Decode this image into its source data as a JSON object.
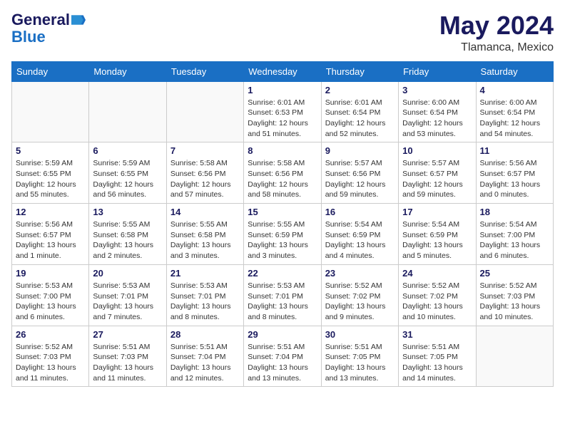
{
  "header": {
    "logo_line1": "General",
    "logo_line2": "Blue",
    "month_year": "May 2024",
    "location": "Tlamanca, Mexico"
  },
  "days_of_week": [
    "Sunday",
    "Monday",
    "Tuesday",
    "Wednesday",
    "Thursday",
    "Friday",
    "Saturday"
  ],
  "weeks": [
    [
      {
        "day": "",
        "detail": ""
      },
      {
        "day": "",
        "detail": ""
      },
      {
        "day": "",
        "detail": ""
      },
      {
        "day": "1",
        "detail": "Sunrise: 6:01 AM\nSunset: 6:53 PM\nDaylight: 12 hours\nand 51 minutes."
      },
      {
        "day": "2",
        "detail": "Sunrise: 6:01 AM\nSunset: 6:54 PM\nDaylight: 12 hours\nand 52 minutes."
      },
      {
        "day": "3",
        "detail": "Sunrise: 6:00 AM\nSunset: 6:54 PM\nDaylight: 12 hours\nand 53 minutes."
      },
      {
        "day": "4",
        "detail": "Sunrise: 6:00 AM\nSunset: 6:54 PM\nDaylight: 12 hours\nand 54 minutes."
      }
    ],
    [
      {
        "day": "5",
        "detail": "Sunrise: 5:59 AM\nSunset: 6:55 PM\nDaylight: 12 hours\nand 55 minutes."
      },
      {
        "day": "6",
        "detail": "Sunrise: 5:59 AM\nSunset: 6:55 PM\nDaylight: 12 hours\nand 56 minutes."
      },
      {
        "day": "7",
        "detail": "Sunrise: 5:58 AM\nSunset: 6:56 PM\nDaylight: 12 hours\nand 57 minutes."
      },
      {
        "day": "8",
        "detail": "Sunrise: 5:58 AM\nSunset: 6:56 PM\nDaylight: 12 hours\nand 58 minutes."
      },
      {
        "day": "9",
        "detail": "Sunrise: 5:57 AM\nSunset: 6:56 PM\nDaylight: 12 hours\nand 59 minutes."
      },
      {
        "day": "10",
        "detail": "Sunrise: 5:57 AM\nSunset: 6:57 PM\nDaylight: 12 hours\nand 59 minutes."
      },
      {
        "day": "11",
        "detail": "Sunrise: 5:56 AM\nSunset: 6:57 PM\nDaylight: 13 hours\nand 0 minutes."
      }
    ],
    [
      {
        "day": "12",
        "detail": "Sunrise: 5:56 AM\nSunset: 6:57 PM\nDaylight: 13 hours\nand 1 minute."
      },
      {
        "day": "13",
        "detail": "Sunrise: 5:55 AM\nSunset: 6:58 PM\nDaylight: 13 hours\nand 2 minutes."
      },
      {
        "day": "14",
        "detail": "Sunrise: 5:55 AM\nSunset: 6:58 PM\nDaylight: 13 hours\nand 3 minutes."
      },
      {
        "day": "15",
        "detail": "Sunrise: 5:55 AM\nSunset: 6:59 PM\nDaylight: 13 hours\nand 3 minutes."
      },
      {
        "day": "16",
        "detail": "Sunrise: 5:54 AM\nSunset: 6:59 PM\nDaylight: 13 hours\nand 4 minutes."
      },
      {
        "day": "17",
        "detail": "Sunrise: 5:54 AM\nSunset: 6:59 PM\nDaylight: 13 hours\nand 5 minutes."
      },
      {
        "day": "18",
        "detail": "Sunrise: 5:54 AM\nSunset: 7:00 PM\nDaylight: 13 hours\nand 6 minutes."
      }
    ],
    [
      {
        "day": "19",
        "detail": "Sunrise: 5:53 AM\nSunset: 7:00 PM\nDaylight: 13 hours\nand 6 minutes."
      },
      {
        "day": "20",
        "detail": "Sunrise: 5:53 AM\nSunset: 7:01 PM\nDaylight: 13 hours\nand 7 minutes."
      },
      {
        "day": "21",
        "detail": "Sunrise: 5:53 AM\nSunset: 7:01 PM\nDaylight: 13 hours\nand 8 minutes."
      },
      {
        "day": "22",
        "detail": "Sunrise: 5:53 AM\nSunset: 7:01 PM\nDaylight: 13 hours\nand 8 minutes."
      },
      {
        "day": "23",
        "detail": "Sunrise: 5:52 AM\nSunset: 7:02 PM\nDaylight: 13 hours\nand 9 minutes."
      },
      {
        "day": "24",
        "detail": "Sunrise: 5:52 AM\nSunset: 7:02 PM\nDaylight: 13 hours\nand 10 minutes."
      },
      {
        "day": "25",
        "detail": "Sunrise: 5:52 AM\nSunset: 7:03 PM\nDaylight: 13 hours\nand 10 minutes."
      }
    ],
    [
      {
        "day": "26",
        "detail": "Sunrise: 5:52 AM\nSunset: 7:03 PM\nDaylight: 13 hours\nand 11 minutes."
      },
      {
        "day": "27",
        "detail": "Sunrise: 5:51 AM\nSunset: 7:03 PM\nDaylight: 13 hours\nand 11 minutes."
      },
      {
        "day": "28",
        "detail": "Sunrise: 5:51 AM\nSunset: 7:04 PM\nDaylight: 13 hours\nand 12 minutes."
      },
      {
        "day": "29",
        "detail": "Sunrise: 5:51 AM\nSunset: 7:04 PM\nDaylight: 13 hours\nand 13 minutes."
      },
      {
        "day": "30",
        "detail": "Sunrise: 5:51 AM\nSunset: 7:05 PM\nDaylight: 13 hours\nand 13 minutes."
      },
      {
        "day": "31",
        "detail": "Sunrise: 5:51 AM\nSunset: 7:05 PM\nDaylight: 13 hours\nand 14 minutes."
      },
      {
        "day": "",
        "detail": ""
      }
    ]
  ]
}
